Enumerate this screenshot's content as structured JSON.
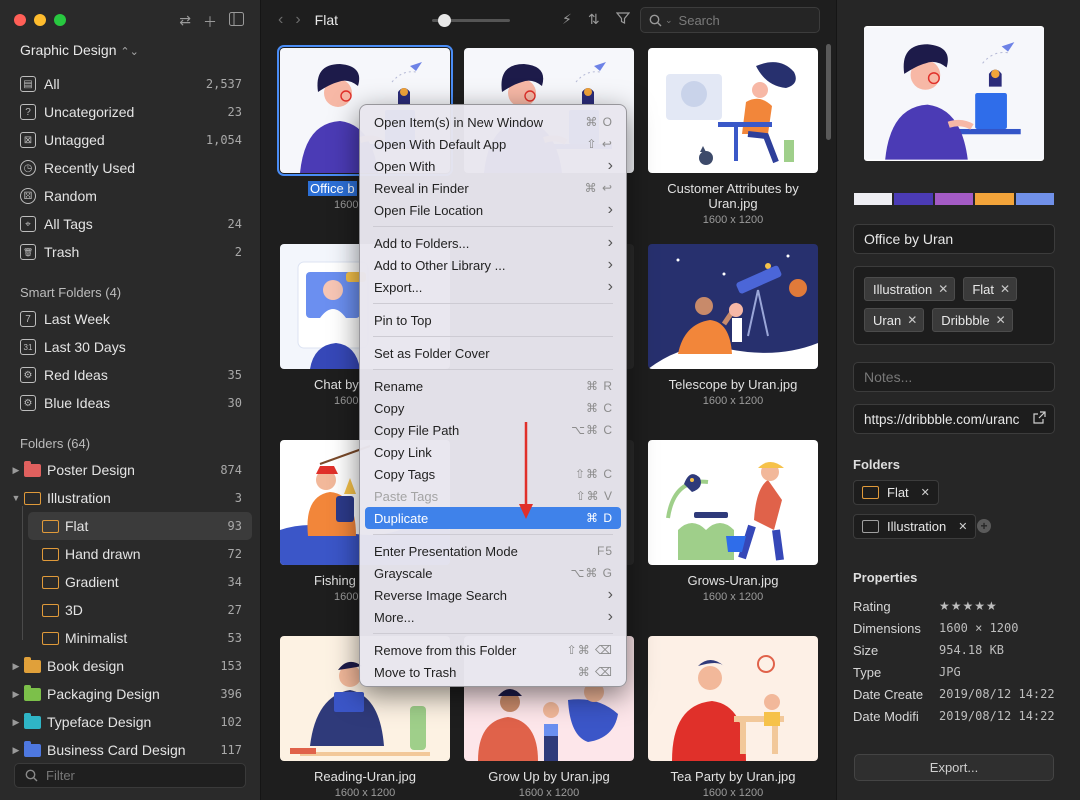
{
  "sidebar": {
    "library": "Graphic Design",
    "smart_items": [
      {
        "label": "All",
        "count": "2,537",
        "icon": "all-icon"
      },
      {
        "label": "Uncategorized",
        "count": "23",
        "icon": "uncategorized-icon"
      },
      {
        "label": "Untagged",
        "count": "1,054",
        "icon": "untagged-icon"
      },
      {
        "label": "Recently Used",
        "count": "",
        "icon": "clock-icon"
      },
      {
        "label": "Random",
        "count": "",
        "icon": "random-icon"
      },
      {
        "label": "All Tags",
        "count": "24",
        "icon": "tag-icon"
      },
      {
        "label": "Trash",
        "count": "2",
        "icon": "trash-icon"
      }
    ],
    "smart_folders_heading": "Smart Folders (4)",
    "smart_folders": [
      {
        "label": "Last Week",
        "count": "",
        "icon": "calendar-7-icon"
      },
      {
        "label": "Last 30 Days",
        "count": "",
        "icon": "calendar-31-icon"
      },
      {
        "label": "Red Ideas",
        "count": "35",
        "icon": "smart-folder-icon"
      },
      {
        "label": "Blue Ideas",
        "count": "30",
        "icon": "smart-folder-icon"
      }
    ],
    "folders_heading": "Folders (64)",
    "folders": [
      {
        "label": "Poster Design",
        "count": "874",
        "color": "#e0605e",
        "caret": "▶"
      },
      {
        "label": "Illustration",
        "count": "3",
        "color": "#e09a3a",
        "caret": "▼"
      },
      {
        "label": "Flat",
        "count": "93",
        "color": "#e09a3a",
        "caret": ""
      },
      {
        "label": "Hand drawn",
        "count": "72",
        "color": "#e09a3a",
        "caret": ""
      },
      {
        "label": "Gradient",
        "count": "34",
        "color": "#e09a3a",
        "caret": ""
      },
      {
        "label": "3D",
        "count": "27",
        "color": "#e09a3a",
        "caret": ""
      },
      {
        "label": "Minimalist",
        "count": "53",
        "color": "#e09a3a",
        "caret": ""
      },
      {
        "label": "Book design",
        "count": "153",
        "color": "#e0a03a",
        "caret": "▶"
      },
      {
        "label": "Packaging Design",
        "count": "396",
        "color": "#7cc04a",
        "caret": "▶"
      },
      {
        "label": "Typeface Design",
        "count": "102",
        "color": "#2fb5c6",
        "caret": "▶"
      },
      {
        "label": "Business Card Design",
        "count": "117",
        "color": "#4e78e0",
        "caret": "▶"
      }
    ],
    "filter_placeholder": "Filter"
  },
  "toolbar": {
    "back": "‹",
    "forward": "›",
    "title": "Flat",
    "search_placeholder": "Search"
  },
  "grid": {
    "items": [
      {
        "name": "Office by Uran.jpg",
        "name_visible": "Office b",
        "dims": "1600",
        "illus": "office"
      },
      {
        "name": "",
        "dims": "",
        "illus": "office"
      },
      {
        "name": "Customer Attributes by Uran.jpg",
        "dims": "1600 x 1200",
        "illus": "customer"
      },
      {
        "name": "Chat by",
        "dims": "1600",
        "illus": "chat"
      },
      {
        "name": "",
        "dims": "",
        "illus": "blank"
      },
      {
        "name": "Telescope by Uran.jpg",
        "dims": "1600 x 1200",
        "illus": "telescope"
      },
      {
        "name": "Fishing",
        "dims": "1600",
        "illus": "fishing"
      },
      {
        "name": "",
        "dims": "",
        "illus": "blank"
      },
      {
        "name": "Grows-Uran.jpg",
        "dims": "1600 x 1200",
        "illus": "grows"
      },
      {
        "name": "Reading-Uran.jpg",
        "dims": "1600 x 1200",
        "illus": "reading"
      },
      {
        "name": "Grow Up by Uran.jpg",
        "dims": "1600 x 1200",
        "illus": "growup"
      },
      {
        "name": "Tea Party by Uran.jpg",
        "dims": "1600 x 1200",
        "illus": "teaparty"
      }
    ]
  },
  "context_menu": {
    "groups": [
      [
        {
          "label": "Open Item(s) in New Window",
          "shortcut": "⌘ O"
        },
        {
          "label": "Open With Default App",
          "shortcut": "⇧ ↩"
        },
        {
          "label": "Open With",
          "submenu": true
        },
        {
          "label": "Reveal in Finder",
          "shortcut": "⌘ ↩"
        },
        {
          "label": "Open File Location",
          "submenu": true
        }
      ],
      [
        {
          "label": "Add to Folders...",
          "submenu": true
        },
        {
          "label": "Add to Other Library ...",
          "submenu": true
        },
        {
          "label": "Export...",
          "submenu": true
        }
      ],
      [
        {
          "label": "Pin to Top"
        }
      ],
      [
        {
          "label": "Set as Folder Cover"
        }
      ],
      [
        {
          "label": "Rename",
          "shortcut": "⌘ R"
        },
        {
          "label": "Copy",
          "shortcut": "⌘ C"
        },
        {
          "label": "Copy File Path",
          "shortcut": "⌥⌘ C"
        },
        {
          "label": "Copy Link"
        },
        {
          "label": "Copy Tags",
          "shortcut": "⇧⌘ C"
        },
        {
          "label": "Paste Tags",
          "shortcut": "⇧⌘ V",
          "disabled": true
        },
        {
          "label": "Duplicate",
          "shortcut": "⌘ D",
          "highlighted": true
        }
      ],
      [
        {
          "label": "Enter Presentation Mode",
          "shortcut": "F5"
        },
        {
          "label": "Grayscale",
          "shortcut": "⌥⌘ G"
        },
        {
          "label": "Reverse Image Search",
          "submenu": true
        },
        {
          "label": "More...",
          "submenu": true
        }
      ],
      [
        {
          "label": "Remove from this Folder",
          "shortcut": "⇧⌘ ⌫"
        },
        {
          "label": "Move to Trash",
          "shortcut": "⌘ ⌫"
        }
      ]
    ]
  },
  "panel": {
    "palette": [
      "#eeeef3",
      "#4b3bb5",
      "#a45bc5",
      "#f2a43a",
      "#7090e8"
    ],
    "title": "Office by Uran",
    "tags": [
      "Illustration",
      "Flat",
      "Uran",
      "Dribbble"
    ],
    "notes_placeholder": "Notes...",
    "url": "https://dribbble.com/uranc",
    "folders_heading": "Folders",
    "folders": [
      "Flat",
      "Illustration"
    ],
    "properties_heading": "Properties",
    "properties": [
      {
        "key": "Rating",
        "value": "★★★★★"
      },
      {
        "key": "Dimensions",
        "value": "1600 × 1200"
      },
      {
        "key": "Size",
        "value": "954.18 KB"
      },
      {
        "key": "Type",
        "value": "JPG"
      },
      {
        "key": "Date Create",
        "value": "2019/08/12 14:22"
      },
      {
        "key": "Date Modifi",
        "value": "2019/08/12 14:22"
      }
    ],
    "export_label": "Export..."
  },
  "accent_color": "#3f82ea"
}
